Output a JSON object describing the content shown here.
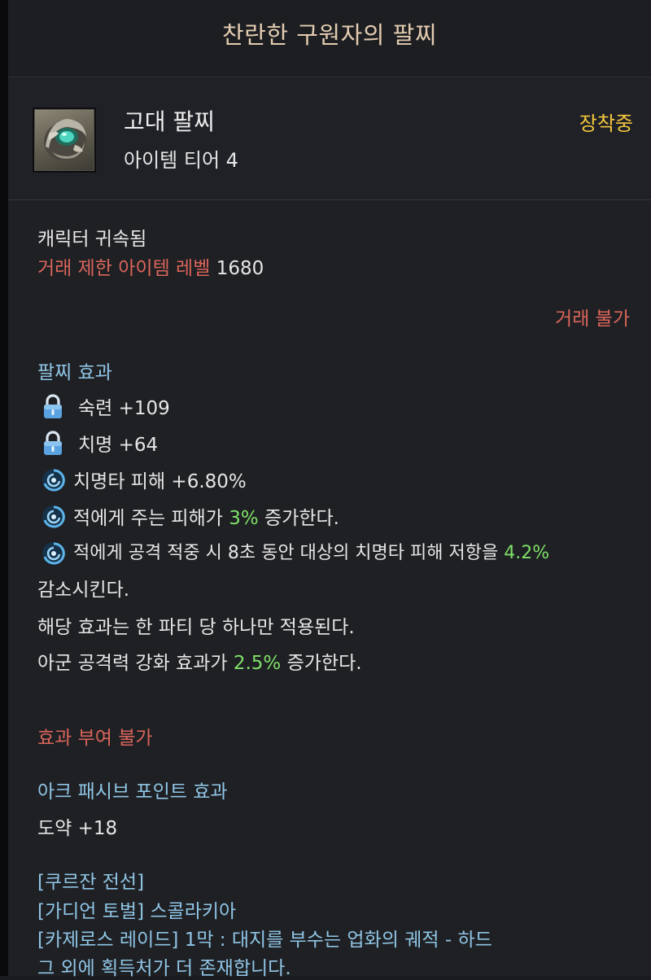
{
  "title": "찬란한 구원자의 팔찌",
  "item": {
    "name": "고대 팔찌",
    "tier": "아이템 티어 4",
    "equipped": "장착중",
    "icon": "bracelet-icon"
  },
  "binding": {
    "bound": "캐릭터 귀속됨",
    "trade_limit_label": "거래 제한 아이템 레벨",
    "trade_limit_value": "1680",
    "tradeable": "거래 불가"
  },
  "effects": {
    "heading": "팔찌 효과",
    "stats": [
      {
        "icon": "lock-icon",
        "text": "숙련 +109"
      },
      {
        "icon": "lock-icon",
        "text": "치명 +64"
      }
    ],
    "specials": [
      {
        "icon": "swirl-icon",
        "text": "치명타 피해 +6.80%"
      },
      {
        "icon": "swirl-icon",
        "pre": "적에게 주는 피해가 ",
        "value": "3%",
        "post": " 증가한다."
      },
      {
        "icon": "swirl-icon",
        "pre": "적에게 공격 적중 시 8초 동안 대상의 치명타 피해 저항을 ",
        "value": "4.2%"
      }
    ],
    "continuation": [
      "감소시킨다.",
      "해당 효과는 한 파티 당 하나만 적용된다."
    ],
    "ally": {
      "pre": "아군 공격력 강화 효과가 ",
      "value": "2.5%",
      "post": " 증가한다."
    }
  },
  "no_grant": "효과 부여 불가",
  "ark_passive": {
    "heading": "아크 패시브 포인트 효과",
    "value": "도약 +18"
  },
  "sources": [
    "[쿠르잔 전선]",
    "[가디언 토벌] 스콜라키아",
    "[카제로스 레이드] 1막 : 대지를 부수는 업화의 궤적 - 하드",
    "그 외에 획득처가 더 존재합니다."
  ],
  "colors": {
    "title": "#e3ccb0",
    "equipped": "#f3c73e",
    "warning": "#d9655a",
    "heading": "#8fc5e5",
    "value": "#7ee068"
  }
}
